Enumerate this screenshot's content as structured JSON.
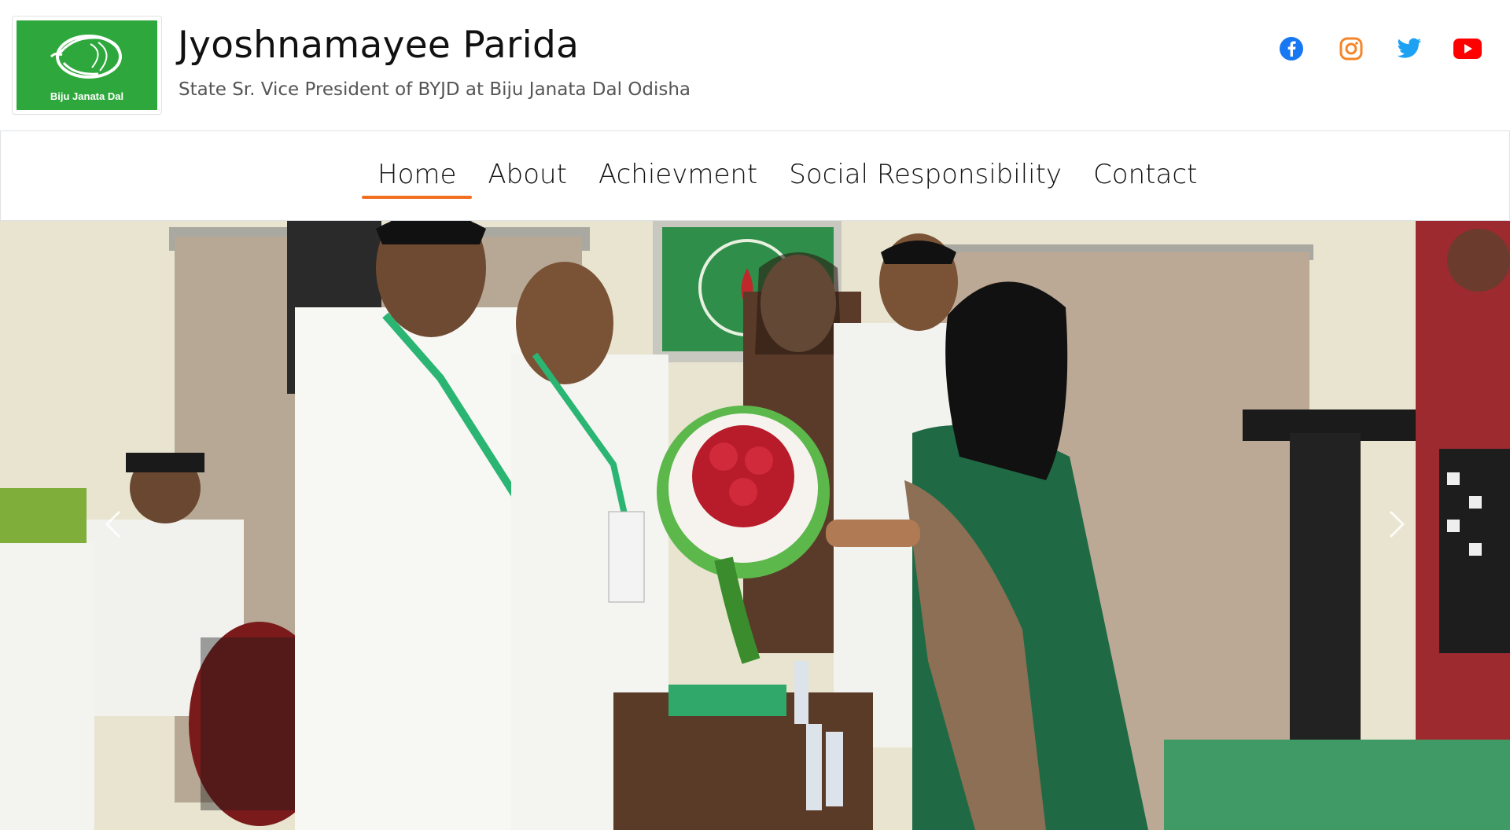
{
  "header": {
    "logo": {
      "caption": "Biju Janata Dal",
      "icon": "conch-shell-icon",
      "color": "#2ea83c"
    },
    "title": "Jyoshnamayee Parida",
    "subtitle": "State Sr. Vice President of BYJD at Biju Janata Dal Odisha",
    "social": [
      {
        "name": "facebook-icon",
        "color": "#1877f2"
      },
      {
        "name": "instagram-icon",
        "color": "#f58529"
      },
      {
        "name": "twitter-icon",
        "color": "#1da1f2"
      },
      {
        "name": "youtube-icon",
        "color": "#ff0000"
      }
    ]
  },
  "nav": {
    "items": [
      {
        "label": "Home",
        "active": true
      },
      {
        "label": "About",
        "active": false
      },
      {
        "label": "Achievment",
        "active": false
      },
      {
        "label": "Social Responsibility",
        "active": false
      },
      {
        "label": "Contact",
        "active": false
      }
    ],
    "accent": "#f26f21"
  },
  "hero": {
    "image": "photo of a group felicitation with a flower bouquet in a meeting room",
    "prev_icon": "chevron-left-icon",
    "next_icon": "chevron-right-icon"
  }
}
